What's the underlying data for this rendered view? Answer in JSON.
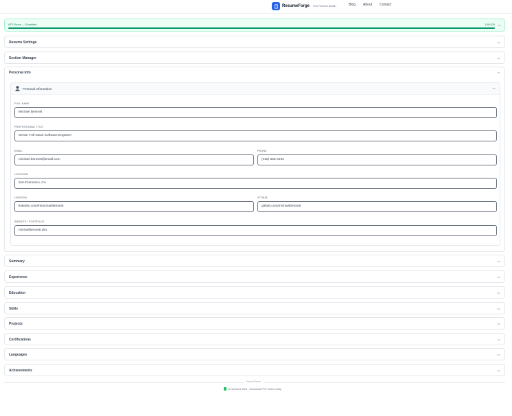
{
  "nav": {
    "brand_name": "ResumeForge",
    "brand_tag": "Free Resume Builder",
    "links": [
      "Blog",
      "About",
      "Contact"
    ]
  },
  "ats": {
    "label": "ATS Score — Excellent",
    "score_text": "100/100",
    "progress": 1.0,
    "color": "#059669"
  },
  "sections": {
    "resume_settings": "Resume Settings",
    "section_manager": "Section Manager",
    "personal_info": "Personal Info",
    "summary": "Summary",
    "experience": "Experience",
    "education": "Education",
    "skills": "Skills",
    "projects": "Projects",
    "certifications": "Certifications",
    "languages": "Languages",
    "achievements": "Achievements"
  },
  "personal": {
    "card_title": "Personal Information",
    "full_name": {
      "label": "FULL NAME",
      "value": "Michael Bennett"
    },
    "title": {
      "label": "PROFESSIONAL TITLE",
      "value": "Senior Full-Stack Software Engineer"
    },
    "email": {
      "label": "EMAIL",
      "value": "michael.bennett@email.com"
    },
    "phone": {
      "label": "PHONE",
      "value": "(415) 555-0192"
    },
    "location": {
      "label": "LOCATION",
      "value": "San Francisco, CA"
    },
    "linkedin": {
      "label": "LINKEDIN",
      "value": "linkedin.com/in/michaelbennett"
    },
    "github": {
      "label": "GITHUB",
      "value": "github.com/michaelbennett"
    },
    "website": {
      "label": "WEBSITE / PORTFOLIO",
      "value": "michaelbennett.dev"
    }
  },
  "footer": {
    "badge": "Result Pane",
    "status": "10 sections filled · Download PDF when ready"
  },
  "colors": {
    "accent": "#2563eb",
    "success": "#059669"
  }
}
